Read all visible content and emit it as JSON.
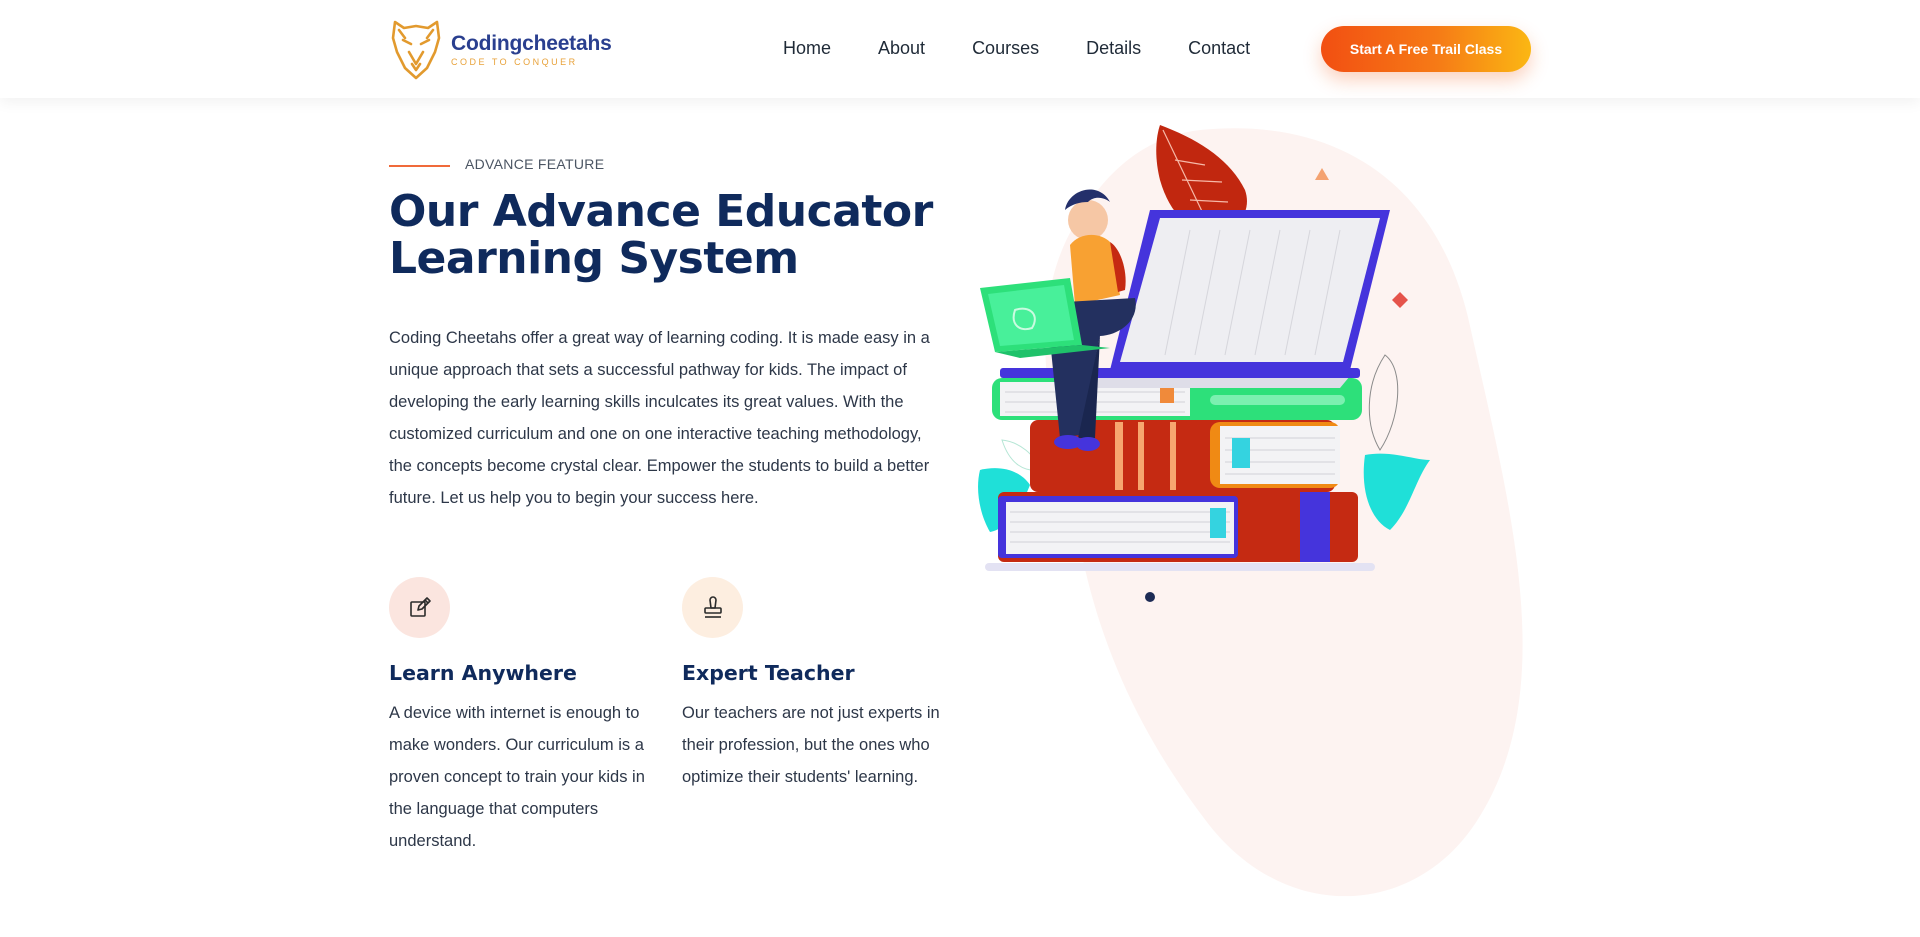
{
  "brand": {
    "name": "Codingcheetahs",
    "tagline": "CODE TO CONQUER",
    "colors": {
      "primary": "#2a3f8f",
      "accent": "#e8a23a",
      "heading": "#0f2a5c"
    }
  },
  "nav": {
    "items": [
      {
        "label": "Home"
      },
      {
        "label": "About"
      },
      {
        "label": "Courses"
      },
      {
        "label": "Details"
      },
      {
        "label": "Contact"
      }
    ],
    "cta_label": "Start A Free Trail Class"
  },
  "section": {
    "eyebrow": "ADVANCE FEATURE",
    "title": "Our Advance Educator Learning System",
    "description": "Coding Cheetahs offer a great way of learning coding. It is made easy in a unique approach that sets a successful pathway for kids. The impact of developing the early learning skills inculcates its great values. With the customized curriculum and one on one interactive teaching methodology, the concepts become crystal clear. Empower the students to build a better future. Let us help you to begin your success here."
  },
  "features": [
    {
      "icon": "edit-icon",
      "title": "Learn Anywhere",
      "description": "A device with internet is enough to make wonders. Our curriculum is a proven concept to train your kids in the language that computers understand."
    },
    {
      "icon": "stamp-icon",
      "title": "Expert Teacher",
      "description": "Our teachers are not just experts in their profession, but the ones who optimize their students' learning."
    }
  ]
}
